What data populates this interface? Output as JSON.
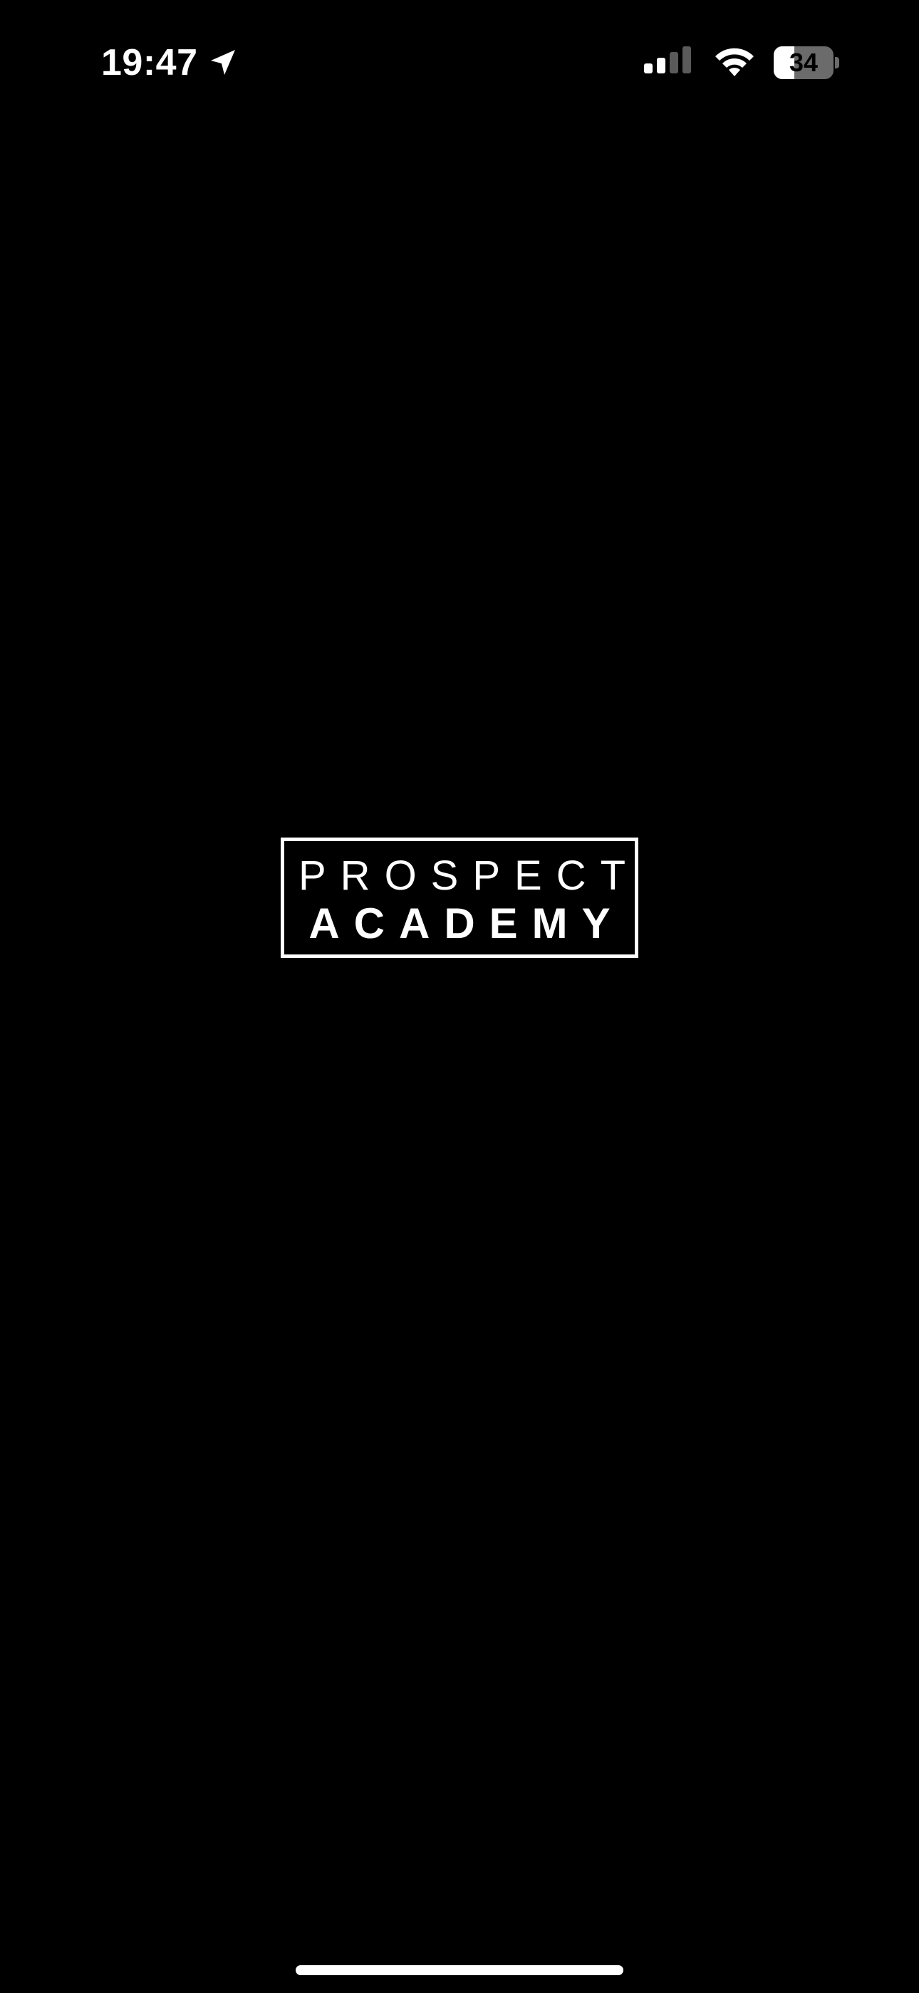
{
  "status_bar": {
    "time": "19:47",
    "location_icon": "location-arrow-icon",
    "cellular_icon": "cellular-signal-icon",
    "wifi_icon": "wifi-icon",
    "battery_level": "34",
    "battery_fraction": 0.34
  },
  "splash": {
    "logo_line_1": "PROSPECT",
    "logo_line_2": "ACADEMY"
  },
  "colors": {
    "background": "#000000",
    "foreground": "#ffffff",
    "battery_empty": "#6b6b6b"
  }
}
